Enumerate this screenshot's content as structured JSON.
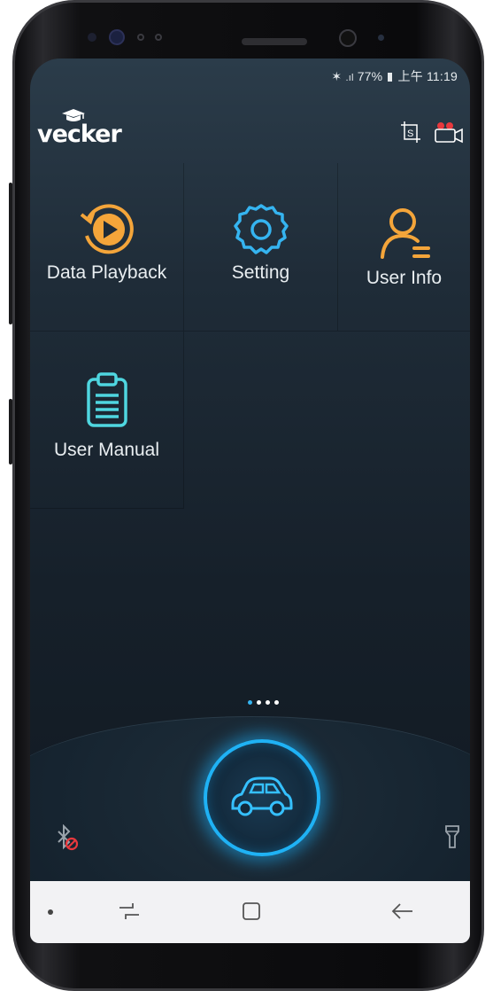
{
  "statusbar": {
    "icons": [
      "bluetooth-icon",
      "signal-icon",
      "battery-icon"
    ],
    "battery": "77%",
    "time": "上午 11:19"
  },
  "app": {
    "logo": "vecker",
    "header_icons": [
      "screenshot-icon",
      "recording-camera-icon"
    ]
  },
  "menu": [
    {
      "label": "Data Playback",
      "icon": "playback-icon",
      "color": "#f4a53a"
    },
    {
      "label": "Setting",
      "icon": "gear-icon",
      "color": "#35b4f0"
    },
    {
      "label": "User Info",
      "icon": "user-info-icon",
      "color": "#f4a53a"
    },
    {
      "label": "User Manual",
      "icon": "clipboard-icon",
      "color": "#4fd6e0"
    }
  ],
  "pager": {
    "count": 4,
    "active": 0
  },
  "dock": {
    "center_icon": "car-icon",
    "left_icon": "bluetooth-disabled-icon",
    "right_icon": "flashlight-icon",
    "accent": "#1fb2f5"
  },
  "navbar": {
    "icons": [
      "recent-apps-icon",
      "home-icon",
      "back-icon"
    ]
  }
}
